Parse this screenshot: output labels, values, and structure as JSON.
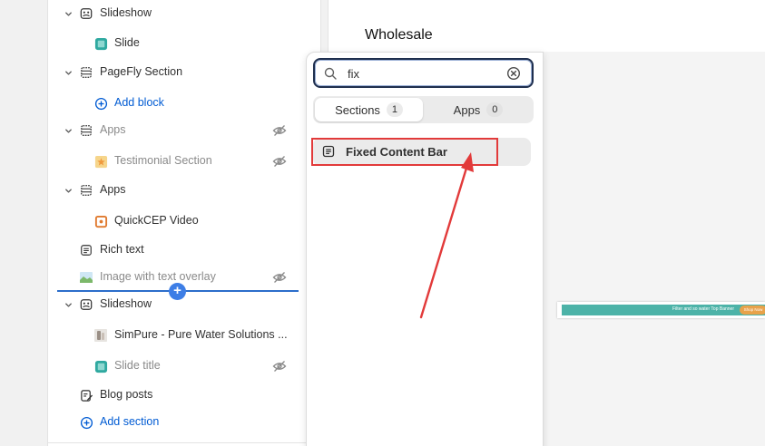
{
  "tree": [
    {
      "key": "slideshow1",
      "label": "Slideshow",
      "icon": "slideshow-icon",
      "chevron": true,
      "muted": false,
      "hidden": false
    },
    {
      "key": "slide",
      "label": "Slide",
      "icon": "slide-image-icon",
      "chevron": false,
      "muted": false,
      "hidden": false
    },
    {
      "key": "pagefly",
      "label": "PageFly Section",
      "icon": "section-icon",
      "chevron": true,
      "muted": false,
      "hidden": false
    },
    {
      "key": "addblock",
      "label": "Add block",
      "icon": "add-circle-icon",
      "chevron": false,
      "muted": false,
      "hidden": false,
      "link": true
    },
    {
      "key": "apps1",
      "label": "Apps",
      "icon": "section-icon",
      "chevron": true,
      "muted": true,
      "hidden": true
    },
    {
      "key": "testimonial",
      "label": "Testimonial Section",
      "icon": "testimonial-app-icon",
      "chevron": false,
      "muted": true,
      "hidden": true
    },
    {
      "key": "apps2",
      "label": "Apps",
      "icon": "section-icon",
      "chevron": true,
      "muted": false,
      "hidden": false
    },
    {
      "key": "quickcep",
      "label": "QuickCEP Video",
      "icon": "quickcep-app-icon",
      "chevron": false,
      "muted": false,
      "hidden": false
    },
    {
      "key": "richtext",
      "label": "Rich text",
      "icon": "text-block-icon",
      "chevron": false,
      "muted": false,
      "hidden": false
    },
    {
      "key": "imagetext",
      "label": "Image with text overlay",
      "icon": "image-thumbnail-icon",
      "chevron": false,
      "muted": true,
      "hidden": true
    },
    {
      "key": "slideshow2",
      "label": "Slideshow",
      "icon": "slideshow-icon",
      "chevron": true,
      "muted": false,
      "hidden": false
    },
    {
      "key": "simpure",
      "label": "SimPure - Pure Water Solutions ...",
      "icon": "product-thumbnail-icon",
      "chevron": false,
      "muted": false,
      "hidden": false
    },
    {
      "key": "slidetitle",
      "label": "Slide title",
      "icon": "slide-image-icon",
      "chevron": false,
      "muted": true,
      "hidden": true
    },
    {
      "key": "blogposts",
      "label": "Blog posts",
      "icon": "blog-edit-icon",
      "chevron": false,
      "muted": false,
      "hidden": false
    },
    {
      "key": "addsection",
      "label": "Add section",
      "icon": "add-circle-icon",
      "chevron": false,
      "muted": false,
      "hidden": false,
      "link": true
    }
  ],
  "preview": {
    "page_heading": "Wholesale",
    "banner_text": "Filter and so water Top Banner",
    "banner_button": "Shop Now"
  },
  "picker": {
    "search_value": "fix",
    "tabs": [
      {
        "label": "Sections",
        "count": "1"
      },
      {
        "label": "Apps",
        "count": "0"
      }
    ],
    "result_label": "Fixed Content Bar"
  },
  "colors": {
    "accent_blue": "#005bd3",
    "highlight_red": "#e23a3a",
    "banner_teal": "#4db3a8"
  }
}
